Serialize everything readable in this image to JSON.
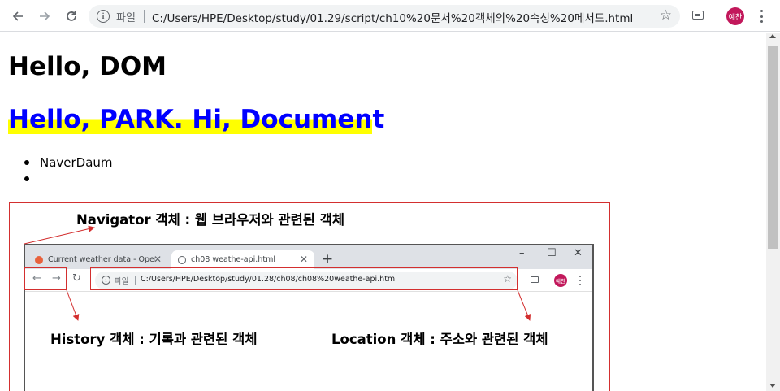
{
  "browser": {
    "omnibox": {
      "scheme_label": "파일",
      "url": "C:/Users/HPE/Desktop/study/01.29/script/ch10%20문서%20객체의%20속성%20메서드.html"
    },
    "profile": {
      "avatar_text": "예찬",
      "avatar_color": "#c2185b"
    },
    "icons": [
      "back-arrow-icon",
      "forward-arrow-icon",
      "reload-icon",
      "info-icon",
      "star-icon",
      "cast-icon",
      "kebab-menu-icon"
    ]
  },
  "page": {
    "heading1": "Hello, DOM",
    "heading2": {
      "text": "Hello, PARK. Hi, Document",
      "highlighted": "Hello, PARK. Hi, Documen",
      "rest": "t",
      "text_color": "#0000ff",
      "highlight_color": "#ffff00"
    },
    "list": [
      {
        "text": "NaverDaum"
      },
      {
        "text": ""
      }
    ],
    "figure": {
      "navigator_label": "Navigator 객체 : 웹 브라우저와 관련된 객체",
      "history_label": "History 객체 : 기록과 관련된 객체",
      "location_label": "Location 객체 : 주소와 관련된 객체",
      "annotation_color": "#d32f2f",
      "screenshot": {
        "tabs": [
          {
            "title": "Current weather data - OpenWe",
            "favicon_color": "#e8613c"
          },
          {
            "title": "ch08 weathe-api.html",
            "favicon_color": "#5f6368"
          }
        ],
        "window_controls": {
          "minimize": "–",
          "maximize": "☐",
          "close": "✕"
        },
        "scheme_label": "파일",
        "url": "C:/Users/HPE/Desktop/study/01.28/ch08/ch08%20weathe-api.html",
        "avatar_text": "예찬"
      }
    }
  }
}
